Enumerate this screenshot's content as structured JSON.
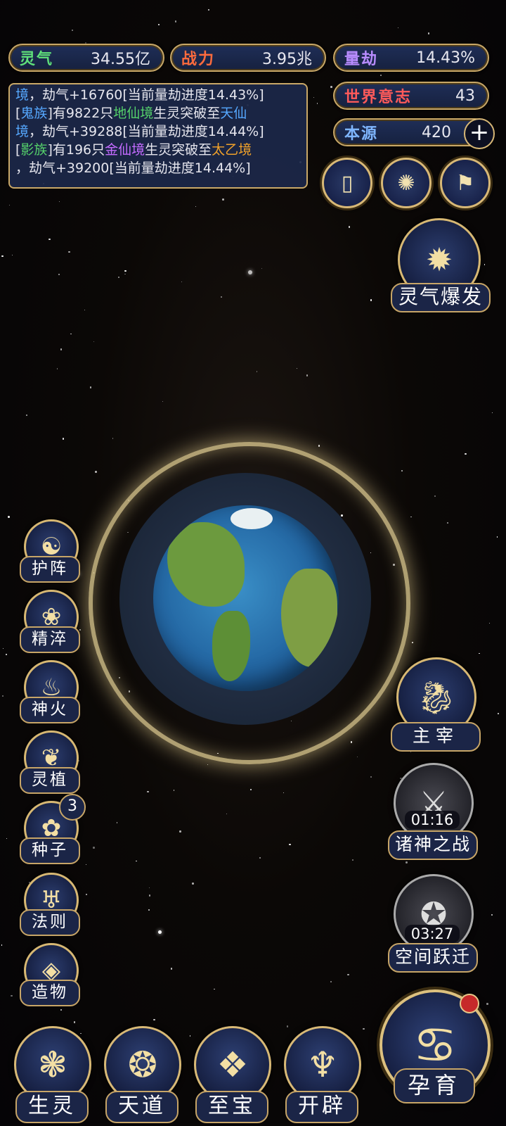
{
  "stats": {
    "lingqi": {
      "label": "灵气",
      "value": "34.55亿",
      "color": "#5fe07a"
    },
    "zhanli": {
      "label": "战力",
      "value": "3.95兆",
      "color": "#ff6b3d"
    },
    "liangjie": {
      "label": "量劫",
      "value": "14.43%",
      "color": "#b88cff"
    },
    "world_will": {
      "label": "世界意志",
      "value": "43",
      "color": "#ff5a5a"
    },
    "origin": {
      "label": "本源",
      "value": "420",
      "color": "#7fb6ff"
    }
  },
  "log": {
    "line1": {
      "a": "境",
      "b": "，劫气+16760[当前量劫进度14.43%]"
    },
    "line2": {
      "a": "[",
      "tribe": "鬼族",
      "b": "]有9822只",
      "realm1": "地仙境",
      "c": "生灵突破至",
      "realm2": "天仙",
      "d": "境",
      "e": "，劫气+39288[当前量劫进度14.44%]"
    },
    "line3": {
      "a": "[",
      "tribe": "影族",
      "b": "]有196只",
      "realm1": "金仙境",
      "c": "生灵突破至",
      "realm2": "太乙境",
      "e": "，劫气+39200[当前量劫进度14.44%]"
    }
  },
  "top_icons": [
    {
      "icon": "card-icon"
    },
    {
      "icon": "vortex-icon"
    },
    {
      "icon": "flag-icon"
    }
  ],
  "burst": {
    "label": "灵气爆发",
    "icon": "burst-icon"
  },
  "left_menu": [
    {
      "label": "护阵",
      "icon": "yinyang-icon"
    },
    {
      "label": "精淬",
      "icon": "lotus-icon"
    },
    {
      "label": "神火",
      "icon": "fire-icon"
    },
    {
      "label": "灵植",
      "icon": "plant-icon"
    },
    {
      "label": "种子",
      "icon": "seed-icon",
      "badge": "3"
    },
    {
      "label": "法则",
      "icon": "law-icon"
    },
    {
      "label": "造物",
      "icon": "craft-icon"
    }
  ],
  "right_menu": {
    "master": {
      "label": "主宰",
      "icon": "dragon-icon"
    },
    "war": {
      "label": "诸神之战",
      "timer": "01:16",
      "icon": "sword-icon"
    },
    "leap": {
      "label": "空间跃迁",
      "timer": "03:27",
      "icon": "portal-icon"
    }
  },
  "bottom_nav": [
    {
      "label": "生灵",
      "icon": "phoenix-icon"
    },
    {
      "label": "天道",
      "icon": "wave-icon"
    },
    {
      "label": "至宝",
      "icon": "treasure-icon"
    },
    {
      "label": "开辟",
      "icon": "axe-icon"
    }
  ],
  "incubate": {
    "label": "孕育",
    "icon": "embryo-icon"
  }
}
